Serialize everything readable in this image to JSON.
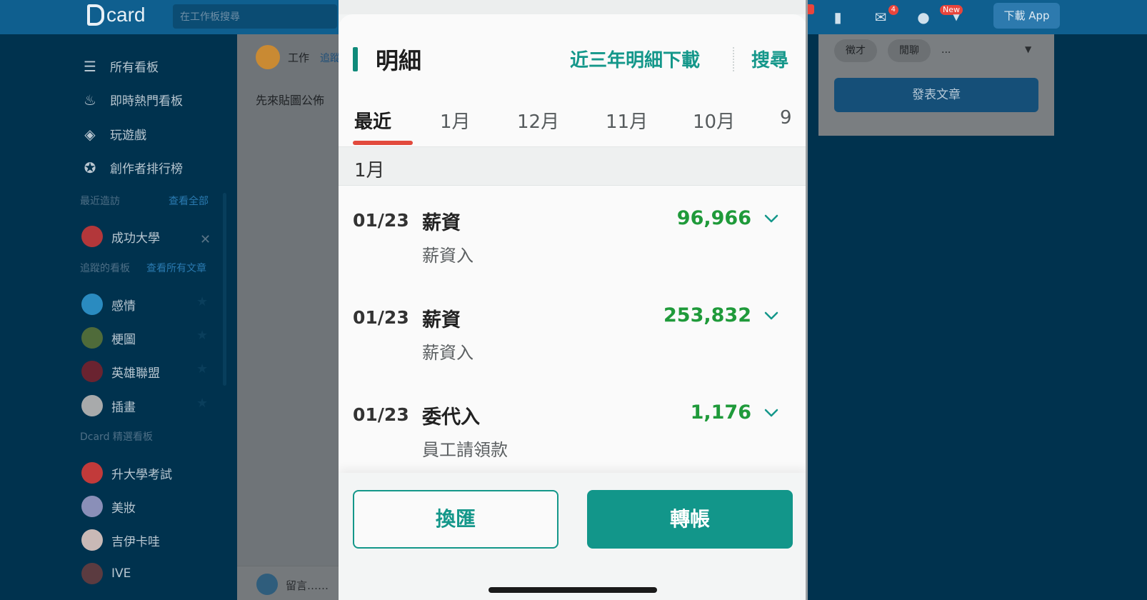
{
  "app": {
    "logo_text": "card",
    "search_placeholder": "在工作板搜尋",
    "mail_badge": "4",
    "new_badge": "New",
    "download_label": "下載 App"
  },
  "sidebar": {
    "nav": [
      {
        "label": "所有看板",
        "icon": "list-icon"
      },
      {
        "label": "即時熱門看板",
        "icon": "fire-icon"
      },
      {
        "label": "玩遊戲",
        "icon": "gamepad-icon"
      },
      {
        "label": "創作者排行榜",
        "icon": "compass-icon"
      }
    ],
    "recent_title": "最近造訪",
    "recent_link": "查看全部",
    "recent": [
      {
        "label": "成功大學"
      }
    ],
    "followed_title": "追蹤的看板",
    "followed_link": "查看所有文章",
    "followed": [
      {
        "label": "感情"
      },
      {
        "label": "梗圖"
      },
      {
        "label": "英雄聯盟"
      },
      {
        "label": "插畫"
      }
    ],
    "featured_title": "Dcard 精選看板",
    "featured": [
      {
        "label": "升大學考試"
      },
      {
        "label": "美妝"
      },
      {
        "label": "吉伊卡哇"
      },
      {
        "label": "IVE"
      }
    ]
  },
  "post": {
    "board": "工作",
    "follow": "追蹤",
    "text": "先來貼圖公佈",
    "comment_placeholder": "留言……"
  },
  "right_panel": {
    "chips": [
      "徵才",
      "閒聊"
    ],
    "more": "...",
    "post_button": "發表文章"
  },
  "phone": {
    "title": "明細",
    "download_link": "近三年明細下載",
    "search_link": "搜尋",
    "tabs": [
      "最近",
      "1月",
      "12月",
      "11月",
      "10月",
      "9"
    ],
    "active_tab": "最近",
    "month_header": "1月",
    "transactions": [
      {
        "date": "01/23",
        "title": "薪資",
        "subtitle": "薪資入",
        "amount": "96,966"
      },
      {
        "date": "01/23",
        "title": "薪資",
        "subtitle": "薪資入",
        "amount": "253,832"
      },
      {
        "date": "01/23",
        "title": "委代入",
        "subtitle": "員工請領款",
        "amount": "1,176"
      }
    ],
    "exchange_button": "換匯",
    "transfer_button": "轉帳",
    "colors": {
      "accent": "#14978a",
      "amount": "#1f9a3a",
      "tab_underline": "#e24a3d"
    }
  }
}
